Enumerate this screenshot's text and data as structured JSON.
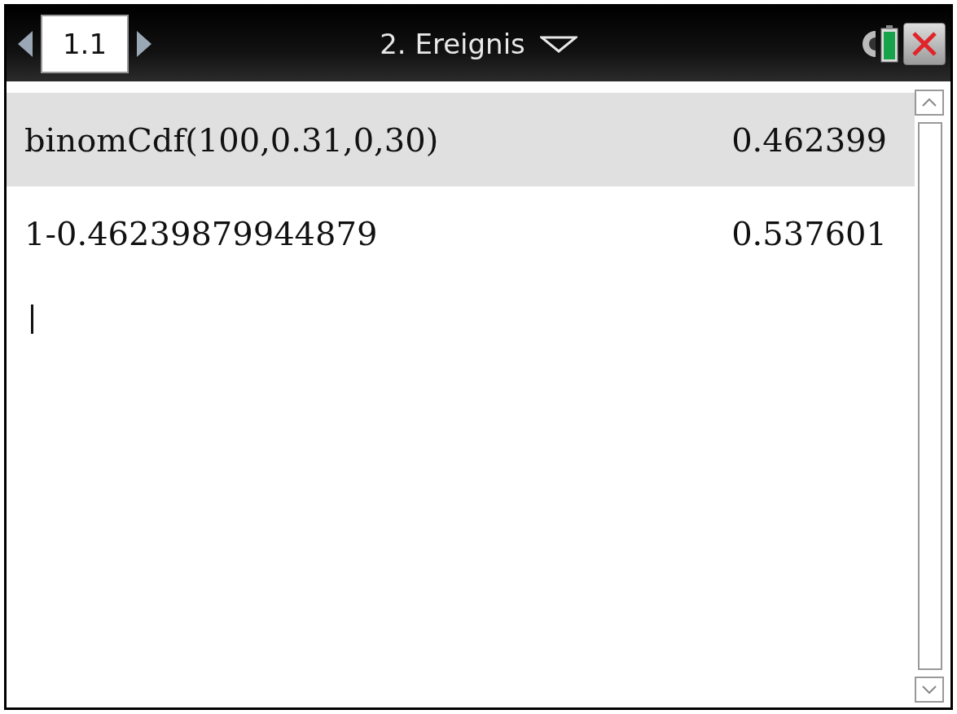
{
  "page_tab": {
    "label": "1.1",
    "selected": true
  },
  "document_title": "2. Ereignis",
  "history": [
    {
      "expression": "binomCdf(100,0.31,0,30)",
      "result": "0.462399",
      "selected": true
    },
    {
      "expression": "1-0.46239879944879",
      "result": "0.537601",
      "selected": false
    }
  ]
}
